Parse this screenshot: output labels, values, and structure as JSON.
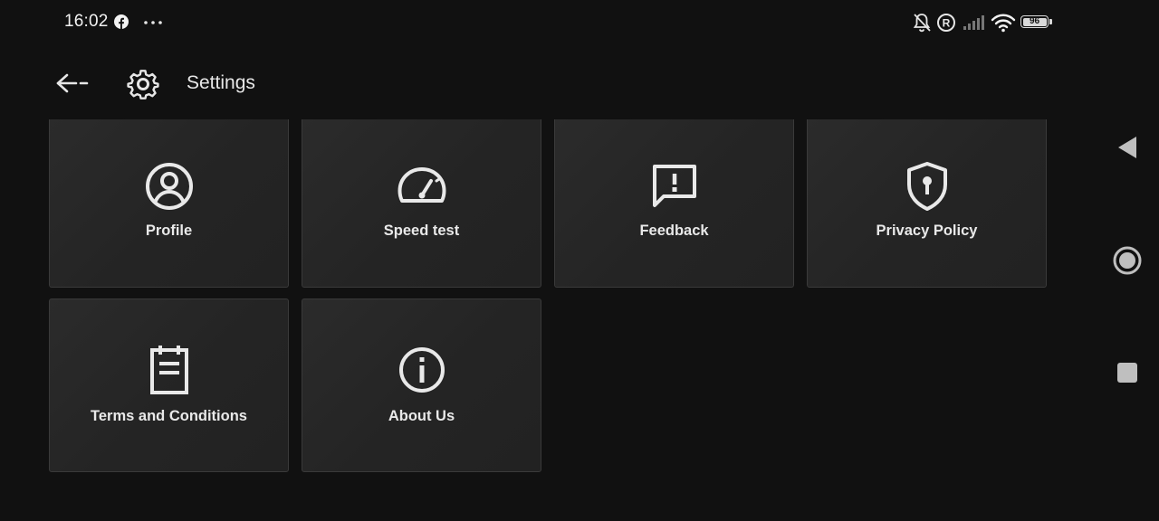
{
  "status_bar": {
    "time": "16:02",
    "battery_level": "96",
    "icons": [
      "facebook-icon",
      "more-dots-icon",
      "bell-muted-icon",
      "registered-icon",
      "signal-icon",
      "wifi-icon",
      "battery-icon"
    ]
  },
  "header": {
    "title": "Settings",
    "back_icon": "arrow-left-icon",
    "title_icon": "gear-icon"
  },
  "tiles": [
    {
      "label": "Profile",
      "icon": "profile-icon"
    },
    {
      "label": "Speed test",
      "icon": "speedometer-icon"
    },
    {
      "label": "Feedback",
      "icon": "feedback-icon"
    },
    {
      "label": "Privacy Policy",
      "icon": "shield-lock-icon"
    },
    {
      "label": "Terms and Conditions",
      "icon": "clipboard-icon"
    },
    {
      "label": "About Us",
      "icon": "info-icon"
    }
  ],
  "nav_bar": {
    "icons": [
      "back-triangle-icon",
      "home-circle-icon",
      "recents-square-icon"
    ]
  },
  "colors": {
    "background": "#111111",
    "tile": "#262626",
    "tile_border": "#3a3a3a",
    "text": "#e9e9e9"
  }
}
